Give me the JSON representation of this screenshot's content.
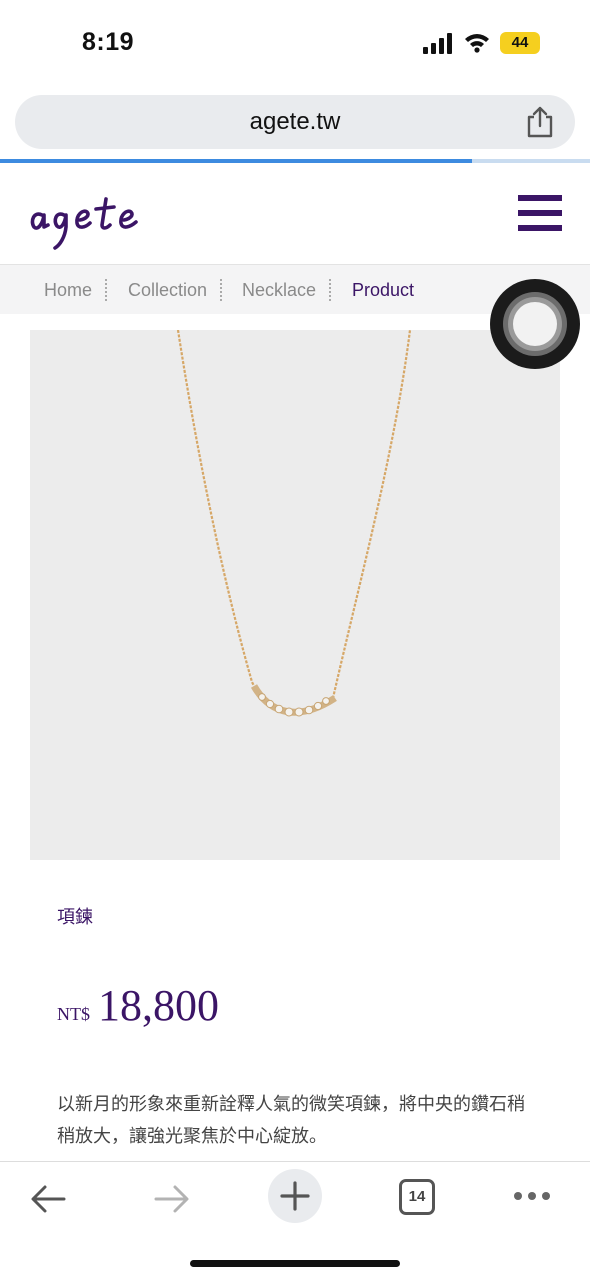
{
  "status_bar": {
    "time": "8:19",
    "battery": "44"
  },
  "browser": {
    "url": "agete.tw",
    "load_progress": 0.8,
    "tab_count": "14"
  },
  "site": {
    "logo_text": "agete"
  },
  "breadcrumb": [
    "Home",
    "Collection",
    "Necklace",
    "Product"
  ],
  "product": {
    "name": "項鍊",
    "currency": "NT$",
    "price": "18,800",
    "description": "以新月的形象來重新詮釋人氣的微笑項鍊，將中央的鑽石稍稍放大，讓強光聚焦於中心綻放。"
  },
  "icons": [
    "signal-icon",
    "wifi-icon",
    "share-icon",
    "menu-icon",
    "back-arrow-icon",
    "forward-arrow-icon",
    "plus-icon",
    "more-icon"
  ],
  "colors": {
    "brand": "#3b1566",
    "progress": "#3d8be0",
    "battery": "#f5cf1f"
  }
}
